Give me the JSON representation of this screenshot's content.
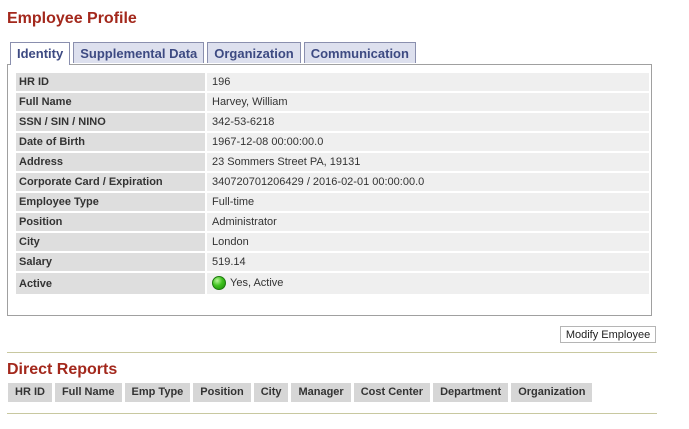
{
  "page_title": "Employee Profile",
  "tabs": [
    {
      "label": "Identity",
      "active": true
    },
    {
      "label": "Supplemental Data",
      "active": false
    },
    {
      "label": "Organization",
      "active": false
    },
    {
      "label": "Communication",
      "active": false
    }
  ],
  "identity": {
    "fields": [
      {
        "label": "HR ID",
        "value": "196"
      },
      {
        "label": "Full Name",
        "value": "Harvey, William"
      },
      {
        "label": "SSN / SIN / NINO",
        "value": "342-53-6218"
      },
      {
        "label": "Date of Birth",
        "value": "1967-12-08 00:00:00.0"
      },
      {
        "label": "Address",
        "value": "23 Sommers Street PA, 19131"
      },
      {
        "label": "Corporate Card / Expiration",
        "value": "340720701206429 / 2016-02-01 00:00:00.0"
      },
      {
        "label": "Employee Type",
        "value": "Full-time"
      },
      {
        "label": "Position",
        "value": "Administrator"
      },
      {
        "label": "City",
        "value": "London"
      },
      {
        "label": "Salary",
        "value": "519.14"
      },
      {
        "label": "Active",
        "value": "Yes, Active",
        "status_icon": "green-status-dot-icon",
        "status_color": "#3fc21e"
      }
    ]
  },
  "modify_button_label": "Modify Employee",
  "direct_reports": {
    "title": "Direct Reports",
    "columns": [
      "HR ID",
      "Full Name",
      "Emp Type",
      "Position",
      "City",
      "Manager",
      "Cost Center",
      "Department",
      "Organization"
    ]
  },
  "colors": {
    "title": "#a3281c",
    "tab_text": "#3d4a82",
    "label_bg": "#dedede",
    "value_bg": "#efefef"
  }
}
